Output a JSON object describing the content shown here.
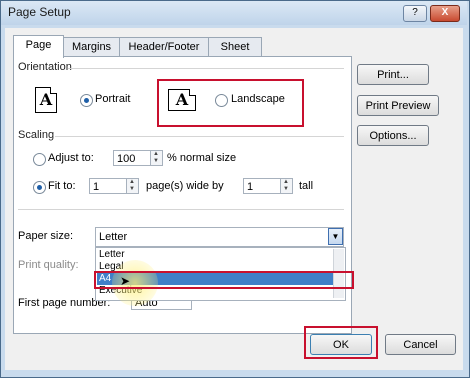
{
  "window": {
    "title": "Page Setup",
    "help_glyph": "?",
    "close_glyph": "X"
  },
  "tabs": [
    "Page",
    "Margins",
    "Header/Footer",
    "Sheet"
  ],
  "orientation": {
    "label": "Orientation",
    "portrait_glyph": "A",
    "portrait_label": "Portrait",
    "landscape_glyph": "A",
    "landscape_label": "Landscape",
    "selected": "portrait"
  },
  "scaling": {
    "label": "Scaling",
    "adjust_label": "Adjust to:",
    "adjust_value": "100",
    "adjust_suffix": "% normal size",
    "fit_label": "Fit to:",
    "fit_wide_value": "1",
    "fit_wide_suffix": "page(s) wide by",
    "fit_tall_value": "1",
    "fit_tall_suffix": "tall",
    "selected": "fit"
  },
  "paper_size": {
    "label": "Paper size:",
    "value": "Letter"
  },
  "print_quality": {
    "label": "Print quality:"
  },
  "first_page_number": {
    "label": "First page number:",
    "value": "Auto"
  },
  "paper_options": [
    "Letter",
    "Legal",
    "A4",
    "Executive"
  ],
  "paper_hovered": "A4",
  "side_buttons": [
    "Print...",
    "Print Preview",
    "Options..."
  ],
  "footer": {
    "ok": "OK",
    "cancel": "Cancel"
  },
  "colors": {
    "highlight": "#c8102e",
    "selection": "#3f7fc8",
    "title_bar": "#c9dbed"
  }
}
